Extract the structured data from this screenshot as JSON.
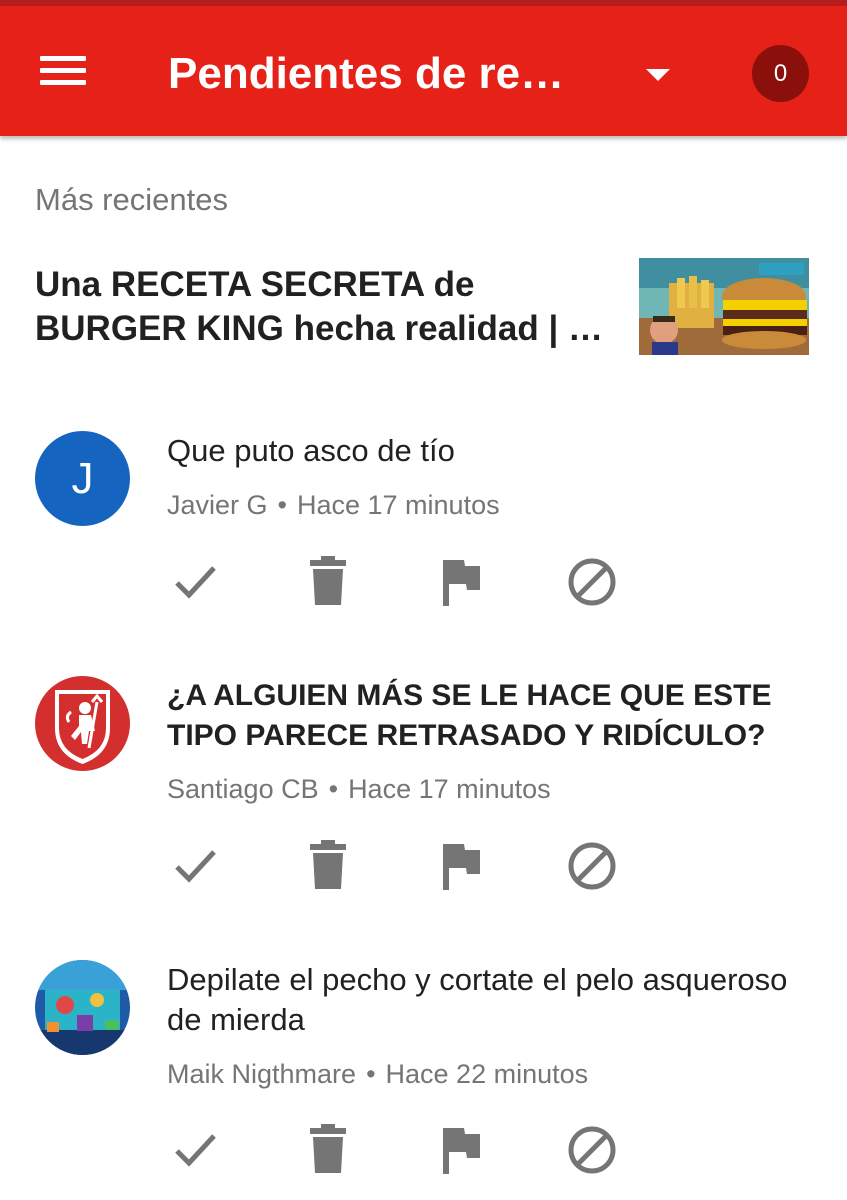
{
  "app_bar": {
    "title": "Pendientes de rev…",
    "notification_count": "0",
    "color": "#e62117"
  },
  "section": {
    "label": "Más recientes"
  },
  "video": {
    "title": "Una RECETA SECRETA de BURGER KING hecha realidad | …"
  },
  "comments": [
    {
      "author": "Javier G",
      "time": "Hace 17 minutos",
      "text": "Que puto asco de tío",
      "avatar_letter": "J",
      "avatar_color": "#1565c0"
    },
    {
      "author": "Santiago CB",
      "time": "Hace 17 minutos",
      "text": "¿A ALGUIEN MÁS SE LE HACE QUE ESTE TIPO PARECE RETRASADO Y RIDÍCULO?",
      "avatar_icon": "red-shield-devil-icon"
    },
    {
      "author": "Maik Nigthmare",
      "time": "Hace 22 minutos",
      "text": "Depilate el pecho y cortate el pelo asqueroso de mierda",
      "avatar_icon": "blue-game-scene-avatar"
    }
  ],
  "action_icons": [
    "approve-check-icon",
    "delete-trash-icon",
    "flag-icon",
    "block-icon"
  ]
}
